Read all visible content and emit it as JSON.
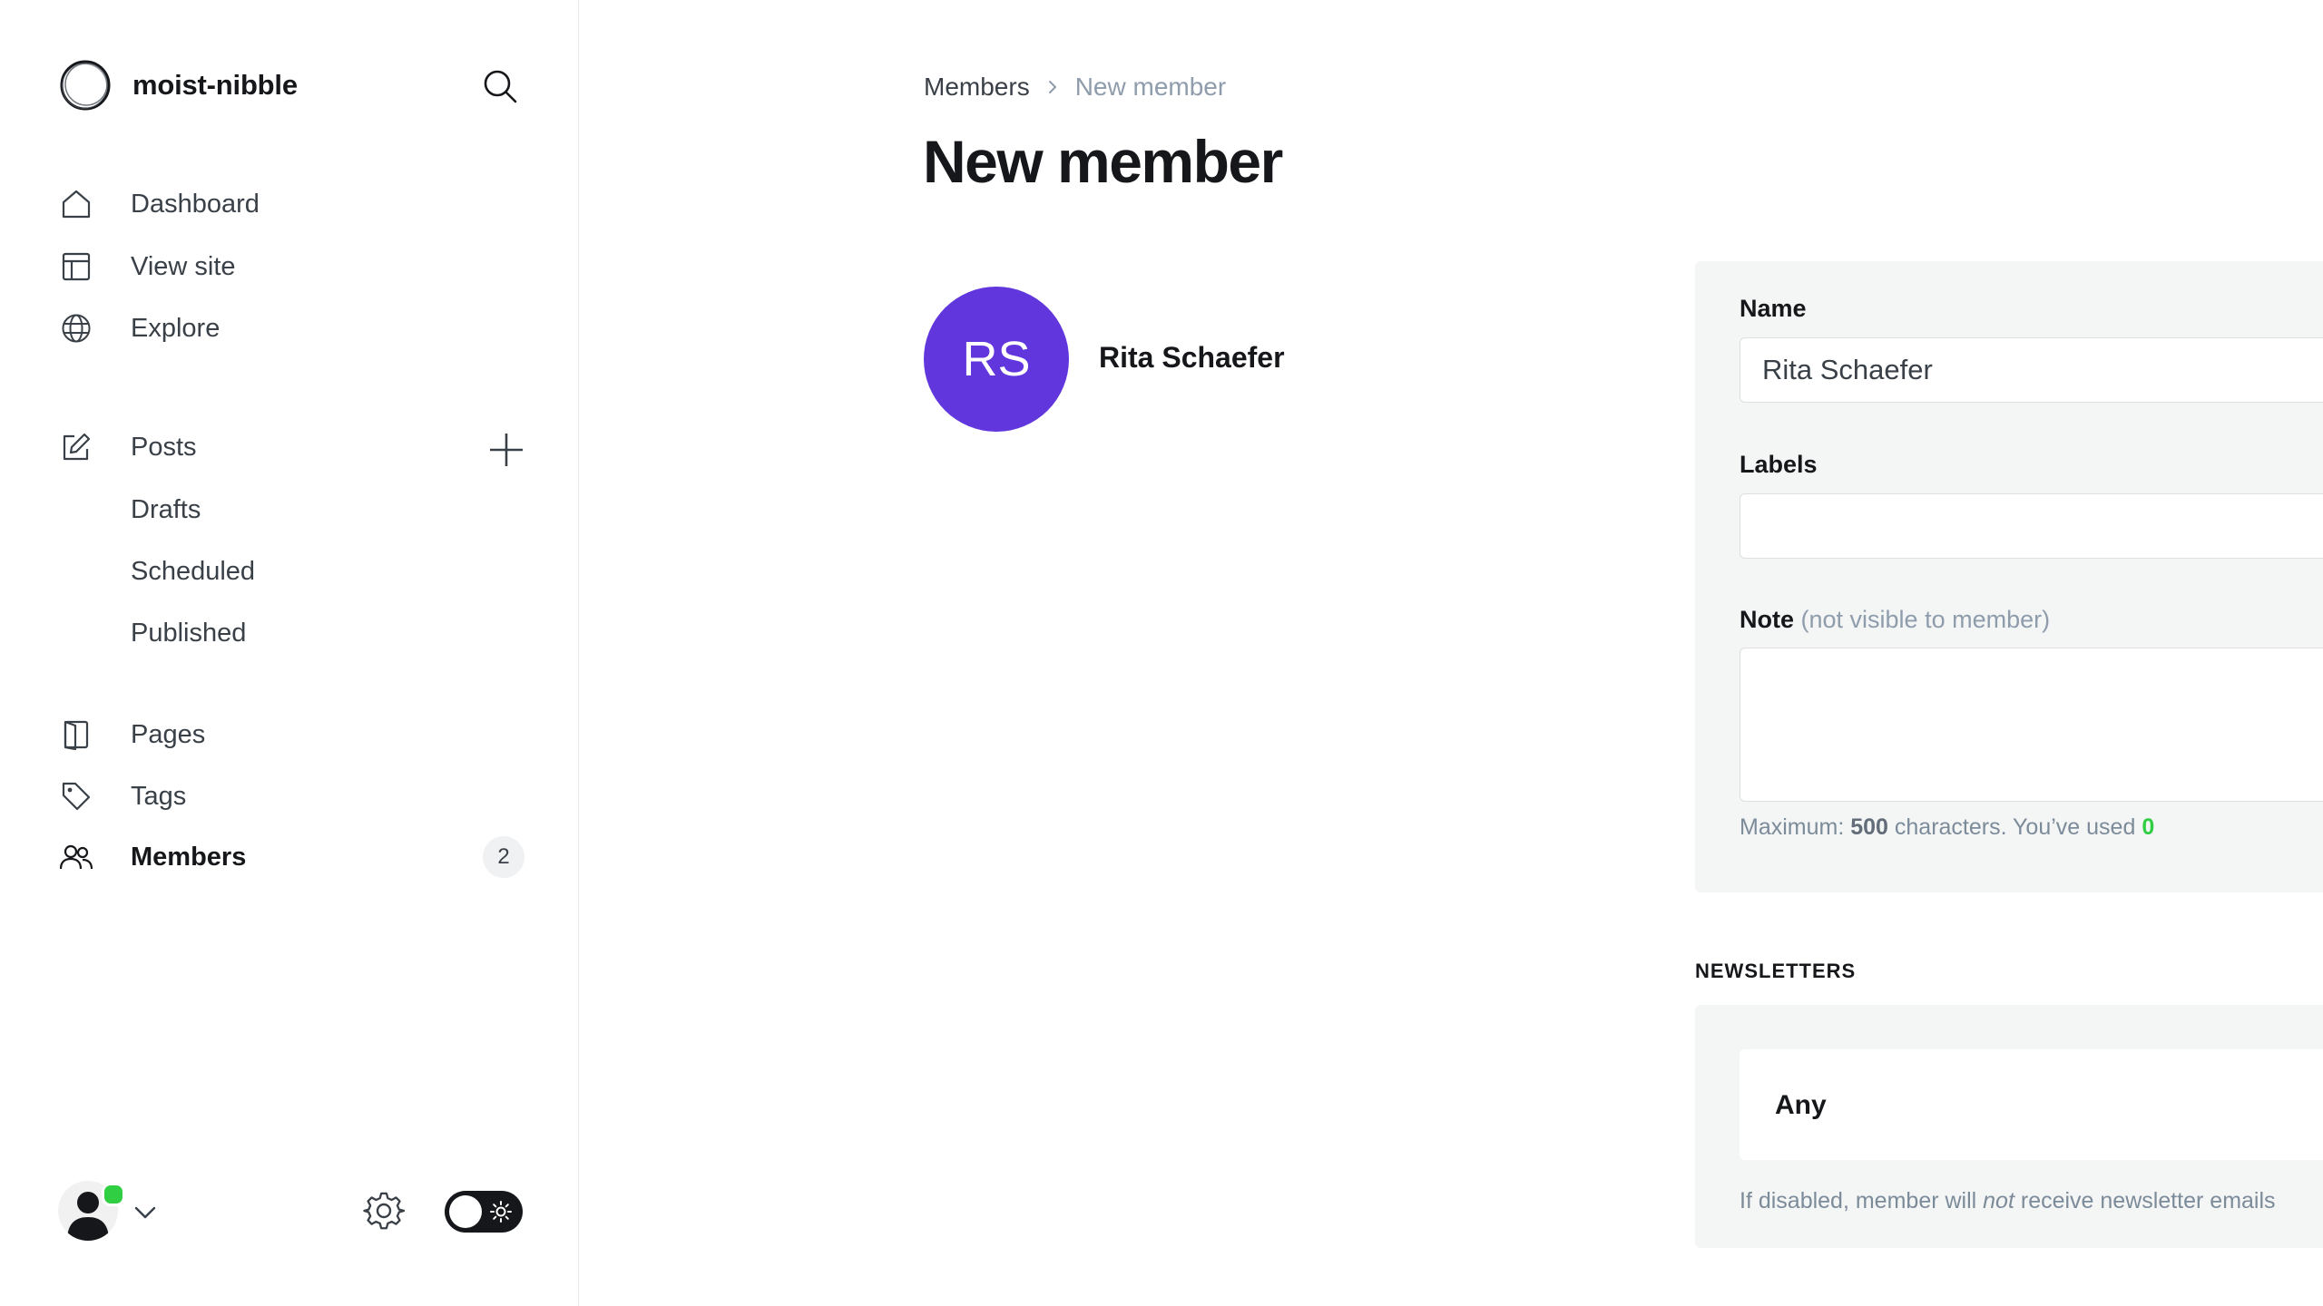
{
  "sidebar": {
    "site_name": "moist-nibble",
    "nav": {
      "dashboard": "Dashboard",
      "view_site": "View site",
      "explore": "Explore",
      "posts": "Posts",
      "drafts": "Drafts",
      "scheduled": "Scheduled",
      "published": "Published",
      "pages": "Pages",
      "tags": "Tags",
      "members": "Members",
      "members_count": "2"
    },
    "icons": [
      "search-icon",
      "home-icon",
      "layout-icon",
      "globe-icon",
      "edit-icon",
      "plus-icon",
      "page-icon",
      "tag-icon",
      "members-icon",
      "user-avatar-icon",
      "chevron-down-icon",
      "gear-icon",
      "sun-icon"
    ],
    "user_status_color": "#30cf43"
  },
  "breadcrumb": {
    "parent": "Members",
    "current": "New member"
  },
  "page": {
    "title": "New member"
  },
  "member": {
    "initials": "RS",
    "name": "Rita Schaefer",
    "avatar_color": "#6236dd"
  },
  "form": {
    "name_label": "Name",
    "name_value": "Rita Schaefer",
    "labels_label": "Labels",
    "labels_value": "",
    "note_label": "Note",
    "note_hint": "(not visible to member)",
    "note_value": "",
    "char_prefix": "Maximum: ",
    "char_max": "500",
    "char_middle": " characters. You’ve used ",
    "char_used": "0"
  },
  "newsletters": {
    "section_title": "NEWSLETTERS",
    "item_label": "Any",
    "hint_prefix": "If disabled, member will ",
    "hint_emphasis": "not",
    "hint_suffix": " receive newsletter emails"
  }
}
